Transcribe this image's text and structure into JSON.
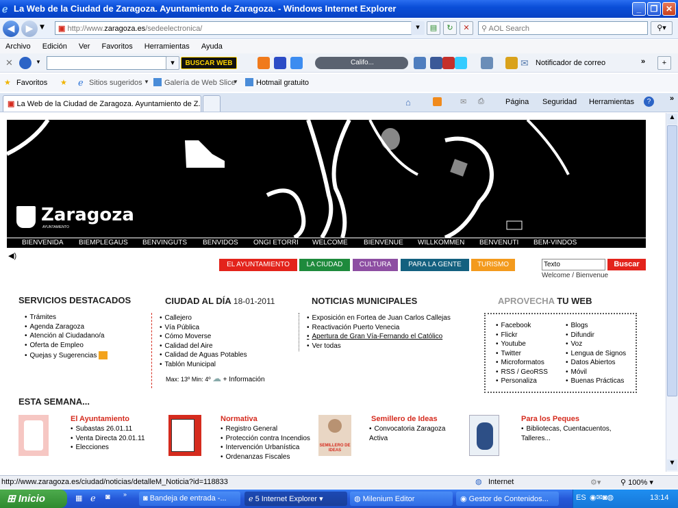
{
  "window": {
    "title": "La Web de la Ciudad de Zaragoza. Ayuntamiento de Zaragoza. - Windows Internet Explorer"
  },
  "address": {
    "url_prefix": "http://www.",
    "url_domain": "zaragoza.es",
    "url_path": "/sedeelectronica/",
    "search_placeholder": "AOL Search"
  },
  "menu": [
    "Archivo",
    "Edición",
    "Ver",
    "Favoritos",
    "Herramientas",
    "Ayuda"
  ],
  "toolbar": {
    "buscar_web": "BUSCAR WEB",
    "weather": "Califo...",
    "notifier": "Notificador de correo"
  },
  "favbar": {
    "favoritos": "Favoritos",
    "sitios": "Sitios sugeridos",
    "galeria": "Galería de Web Slice",
    "hotmail": "Hotmail gratuito"
  },
  "tabbar": {
    "tab_title": "La Web de la Ciudad de Zaragoza. Ayuntamiento de Z...",
    "pagina": "Página",
    "seguridad": "Seguridad",
    "herramientas": "Herramientas"
  },
  "banner": {
    "logo": "Zaragoza",
    "logo_sub": "AYUNTAMIENTO"
  },
  "languages": [
    "BIENVENIDA",
    "BIEMPLEGAUS",
    "BENVINGUTS",
    "BENVIDOS",
    "ONGI ETORRI",
    "WELCOME",
    "BIENVENUE",
    "WILLKOMMEN",
    "BENVENUTI",
    "BEM-VINDOS"
  ],
  "categories": [
    {
      "label": "EL AYUNTAMIENTO",
      "color": "#e3231b"
    },
    {
      "label": "LA CIUDAD",
      "color": "#1e8a3c"
    },
    {
      "label": "CULTURA",
      "color": "#8d4ea2"
    },
    {
      "label": "PARA LA GENTE",
      "color": "#13607f"
    },
    {
      "label": "TURISMO",
      "color": "#f39a1d"
    }
  ],
  "search": {
    "value": "Texto",
    "button": "Buscar",
    "welcome": "Welcome / Bienvenue"
  },
  "servicios": {
    "title": "SERVICIOS DESTACADOS",
    "items": [
      "Trámites",
      "Agenda Zaragoza",
      "Atención al Ciudadano/a",
      "Oferta de Empleo",
      "Quejas y Sugerencias"
    ]
  },
  "ciudad": {
    "title": "CIUDAD AL DÍA",
    "date": "18-01-2011",
    "items": [
      "Callejero",
      "Vía Pública",
      "Cómo Moverse",
      "Calidad del Aire",
      "Calidad de Aguas Potables",
      "Tablón Municipal"
    ],
    "weather": "Max: 13º Min: 4º",
    "more": "+ Información"
  },
  "noticias": {
    "title": "NOTICIAS MUNICIPALES",
    "items": [
      "Exposición en Fortea de Juan Carlos Callejas",
      "Reactivación Puerto Venecia",
      "Apertura de Gran Vía-Fernando el Católico",
      "Ver todas"
    ]
  },
  "aprovecha": {
    "title_a": "APROVECHA",
    "title_b": "TU WEB",
    "col1": [
      "Facebook",
      "Flickr",
      "Youtube",
      "Twitter",
      "Microformatos",
      "RSS / GeoRSS",
      "Personaliza"
    ],
    "col2": [
      "Blogs",
      "Difundir",
      "Voz",
      "Lengua de Signos",
      "Datos Abiertos",
      "Móvil",
      "Buenas Prácticas"
    ]
  },
  "semana": {
    "title": "ESTA SEMANA...",
    "blocks": [
      {
        "title": "El Ayuntamiento",
        "items": [
          "Subastas 26.01.11",
          "Venta Directa 20.01.11",
          "Elecciones"
        ]
      },
      {
        "title": "Normativa",
        "items": [
          "Registro General",
          "Protección contra Incendios",
          "Intervención Urbanística",
          "Ordenanzas Fiscales"
        ]
      },
      {
        "title": "Semillero de Ideas",
        "items": [
          "Convocatoria Zaragoza Activa"
        ],
        "img_label": "SEMILLERO DE IDEAS"
      },
      {
        "title": "Para los Peques",
        "items": [
          "Bibliotecas, Cuentacuentos, Talleres..."
        ]
      }
    ]
  },
  "status": {
    "url": "http://www.zaragoza.es/ciudad/noticias/detalleM_Noticia?id=118833",
    "zone": "Internet",
    "zoom": "100%"
  },
  "taskbar": {
    "start": "Inicio",
    "tasks": [
      "Bandeja de entrada -...",
      "5 Internet Explorer",
      "Milenium Editor",
      "Gestor de Contenidos..."
    ],
    "lang": "ES",
    "clock": "13:14"
  }
}
